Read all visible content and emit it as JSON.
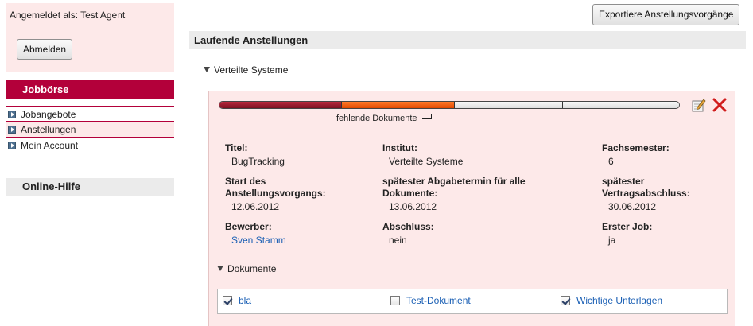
{
  "sidebar": {
    "login_status": "Angemeldet als: Test Agent",
    "logout_label": "Abmelden",
    "nav_title": "Jobbörse",
    "nav_items": [
      {
        "label": "Jobangebote"
      },
      {
        "label": "Anstellungen"
      },
      {
        "label": "Mein Account"
      }
    ],
    "help_title": "Online-Hilfe"
  },
  "main": {
    "export_label": "Exportiere Anstellungsvorgänge",
    "section_title": "Laufende Anstellungen",
    "group_title": "Verteilte Systeme",
    "progress": {
      "label": "fehlende Dokumente",
      "done_fraction": 0.265,
      "active_fraction": 0.245,
      "pending_fractions": [
        0.235,
        0.255
      ]
    },
    "fields": {
      "title_label": "Titel:",
      "title_value": "BugTracking",
      "institute_label": "Institut:",
      "institute_value": "Verteilte Systeme",
      "semester_label": "Fachsemester:",
      "semester_value": "6",
      "start_label_line1": "Start des",
      "start_label_line2": "Anstellungsvorgangs:",
      "start_value": "12.06.2012",
      "deadline_label_line1": "spätester Abgabetermin für alle",
      "deadline_label_line2": "Dokumente:",
      "deadline_value": "13.06.2012",
      "contract_label_line1": "spätester",
      "contract_label_line2": "Vertragsabschluss:",
      "contract_value": "30.06.2012",
      "applicant_label": "Bewerber:",
      "applicant_value": "Sven Stamm",
      "completion_label": "Abschluss:",
      "completion_value": "nein",
      "firstjob_label": "Erster Job:",
      "firstjob_value": "ja"
    },
    "documents": {
      "title": "Dokumente",
      "items": [
        {
          "label": "bla",
          "checked": true
        },
        {
          "label": "Test-Dokument",
          "checked": false
        },
        {
          "label": "Wichtige Unterlagen",
          "checked": true
        }
      ]
    }
  },
  "colors": {
    "brand": "#b3003a",
    "panel_bg": "#fde9e9",
    "link": "#1a5fb4",
    "progress_done": "#8c1526",
    "progress_active": "#f05a0f"
  },
  "icons": {
    "nav_item": "arrow-right-icon",
    "edit": "edit-icon",
    "delete": "delete-icon",
    "expand": "triangle-down-icon"
  }
}
